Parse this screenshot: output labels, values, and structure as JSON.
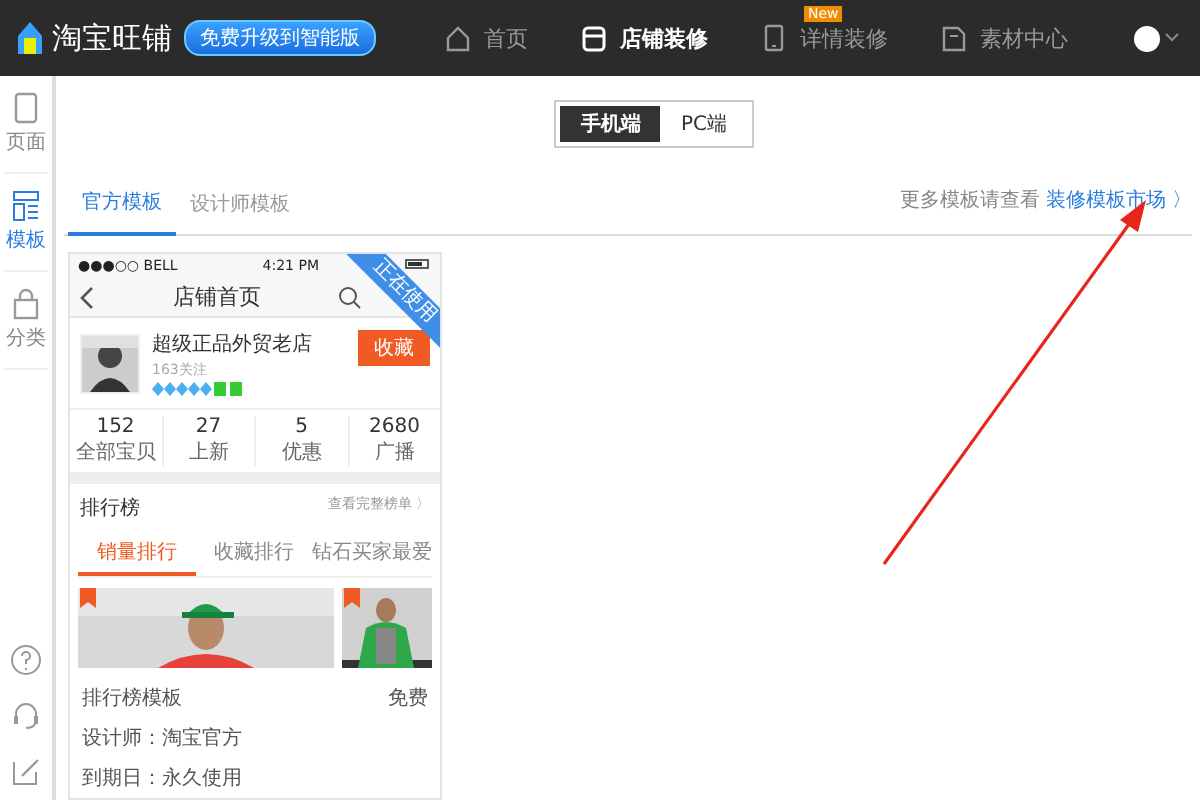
{
  "app": {
    "logo": "淘宝旺铺",
    "upgrade": "免费升级到智能版"
  },
  "nav": [
    {
      "label": "首页",
      "selected": false
    },
    {
      "label": "店铺装修",
      "selected": true
    },
    {
      "label": "详情装修",
      "selected": false,
      "badge": "New"
    },
    {
      "label": "素材中心",
      "selected": false
    }
  ],
  "sidebar": {
    "items": [
      {
        "label": "页面",
        "selected": false
      },
      {
        "label": "模板",
        "selected": true
      },
      {
        "label": "分类",
        "selected": false
      }
    ]
  },
  "device_toggle": [
    {
      "label": "手机端",
      "selected": true
    },
    {
      "label": "PC端",
      "selected": false
    }
  ],
  "tabs": [
    {
      "label": "官方模板",
      "selected": true
    },
    {
      "label": "设计师模板",
      "selected": false
    }
  ],
  "market_hint": {
    "text": "更多模板请查看",
    "link": "装修模板市场 〉"
  },
  "template_card": {
    "status_carrier": "●●●○○ BELL",
    "status_time": "4:21 PM",
    "page_title": "店铺首页",
    "ribbon": "正在使用",
    "shop_name": "超级正品外贸老店",
    "followers": "163关注",
    "collect": "收藏",
    "stats": [
      {
        "value": "152",
        "label": "全部宝贝"
      },
      {
        "value": "27",
        "label": "上新"
      },
      {
        "value": "5",
        "label": "优惠"
      },
      {
        "value": "2680",
        "label": "广播"
      }
    ],
    "ranking_title": "排行榜",
    "ranking_link": "查看完整榜单 〉",
    "ranking_tabs": [
      {
        "label": "销量排行",
        "selected": true
      },
      {
        "label": "收藏排行",
        "selected": false
      },
      {
        "label": "钻石买家最爱",
        "selected": false
      }
    ],
    "template_name": "排行榜模板",
    "price": "免费",
    "designer": "设计师：淘宝官方",
    "expiry": "到期日：永久使用"
  }
}
